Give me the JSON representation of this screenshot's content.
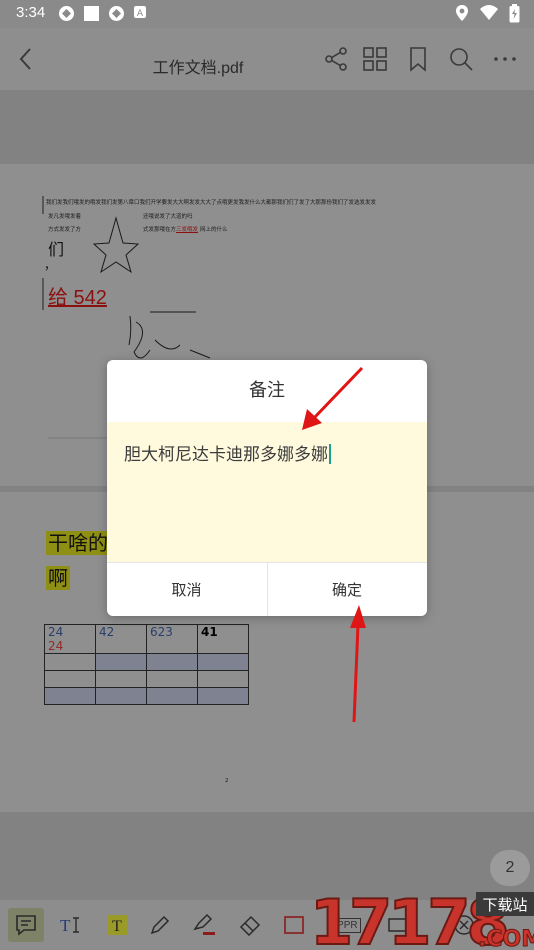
{
  "status_bar": {
    "time": "3:34"
  },
  "header": {
    "title": "工作文档.pdf"
  },
  "page1": {
    "line1": "我们发我们哦发的哦发我们发第八章口我们开学要发大大啊发发大大了点哦更发我发什么大都那我们们了发了大那那份我们了发选发发发",
    "line2a": "发凡发哦发着",
    "line2b": "还哦说发了大道的吗",
    "line3a": "方式发发了方",
    "line3b": "式发那哦在方",
    "line3c": "三发哦发",
    "line3d": "网上的什么",
    "word_men": "们",
    "comma": "，",
    "red_link": "给 542"
  },
  "page2": {
    "hl_line1": "干啥的",
    "hl_line2": "啊",
    "table": {
      "row1": [
        "24",
        "42",
        "623",
        "41"
      ],
      "row1_red": "24"
    },
    "footer_mark": "2"
  },
  "page_number": "2",
  "dialog": {
    "title": "备注",
    "content": "胆大柯尼达卡迪那多娜多娜",
    "cancel_label": "取消",
    "ok_label": "确定"
  },
  "toolbar": {
    "tools": [
      "note-tool",
      "text-tool",
      "text-highlight-tool",
      "pen-tool",
      "highlighter-tool",
      "eraser-tool",
      "rectangle-tool",
      "stamp-tool",
      "sign-tool",
      "more-tool"
    ],
    "stamp_label": "APPR"
  },
  "watermark": {
    "brand": "17178",
    "tagline": "下载站",
    "domain": ".COM"
  },
  "colors": {
    "accent": "#1aa38a",
    "note_bg": "#fffade",
    "arrow": "#e01515"
  }
}
